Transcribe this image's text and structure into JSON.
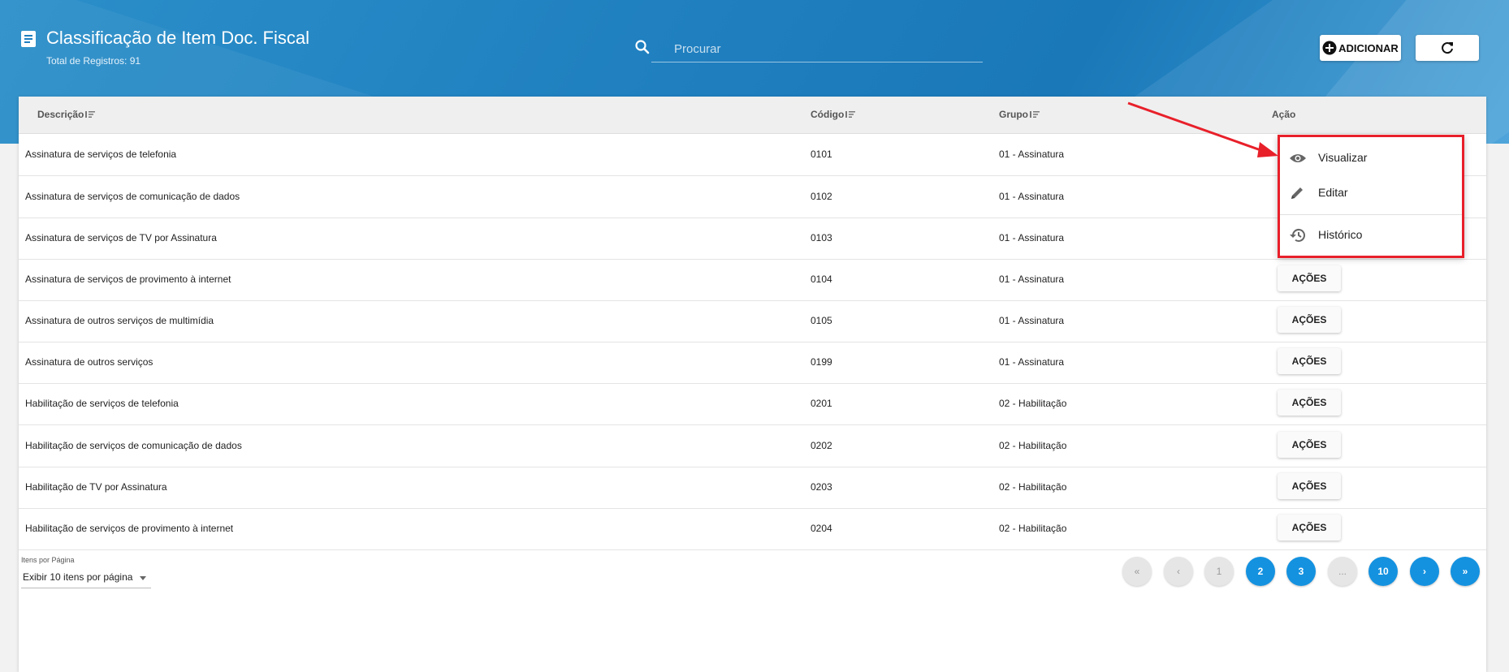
{
  "header": {
    "title": "Classificação de Item Doc. Fiscal",
    "total": "Total de Registros: 91",
    "search_placeholder": "Procurar",
    "add_label": "ADICIONAR"
  },
  "colors": {
    "banner": "#1f7fbf",
    "accent": "#1492e0",
    "highlight": "#e8202a"
  },
  "table": {
    "headers": [
      "Descrição",
      "Código",
      "Grupo",
      "Ação"
    ],
    "rows": [
      {
        "descricao": "Assinatura de serviços de telefonia",
        "codigo": "0101",
        "grupo": "01 - Assinatura"
      },
      {
        "descricao": "Assinatura de serviços de comunicação de dados",
        "codigo": "0102",
        "grupo": "01 - Assinatura"
      },
      {
        "descricao": "Assinatura de serviços de TV por Assinatura",
        "codigo": "0103",
        "grupo": "01 - Assinatura"
      },
      {
        "descricao": "Assinatura de serviços de provimento à internet",
        "codigo": "0104",
        "grupo": "01 - Assinatura",
        "acoes": "AÇÕES"
      },
      {
        "descricao": "Assinatura de outros serviços de multimídia",
        "codigo": "0105",
        "grupo": "01 - Assinatura",
        "acoes": "AÇÕES"
      },
      {
        "descricao": "Assinatura de outros serviços",
        "codigo": "0199",
        "grupo": "01 - Assinatura",
        "acoes": "AÇÕES"
      },
      {
        "descricao": "Habilitação de serviços de telefonia",
        "codigo": "0201",
        "grupo": "02 - Habilitação",
        "acoes": "AÇÕES"
      },
      {
        "descricao": "Habilitação de serviços de comunicação de dados",
        "codigo": "0202",
        "grupo": "02 - Habilitação",
        "acoes": "AÇÕES"
      },
      {
        "descricao": "Habilitação de TV por Assinatura",
        "codigo": "0203",
        "grupo": "02 - Habilitação",
        "acoes": "AÇÕES"
      },
      {
        "descricao": "Habilitação de serviços de provimento à internet",
        "codigo": "0204",
        "grupo": "02 - Habilitação",
        "acoes": "AÇÕES"
      }
    ]
  },
  "menu": {
    "items": [
      {
        "label": "Visualizar",
        "icon": "eye-icon"
      },
      {
        "label": "Editar",
        "icon": "pencil-icon"
      },
      {
        "label": "Histórico",
        "icon": "history-icon"
      }
    ]
  },
  "footer": {
    "items_per_page_label": "Itens por Página",
    "items_per_page_value": "Exibir 10 itens por página",
    "pagination": [
      "«",
      "‹",
      "1",
      "2",
      "3",
      "...",
      "10",
      "›",
      "»"
    ]
  }
}
